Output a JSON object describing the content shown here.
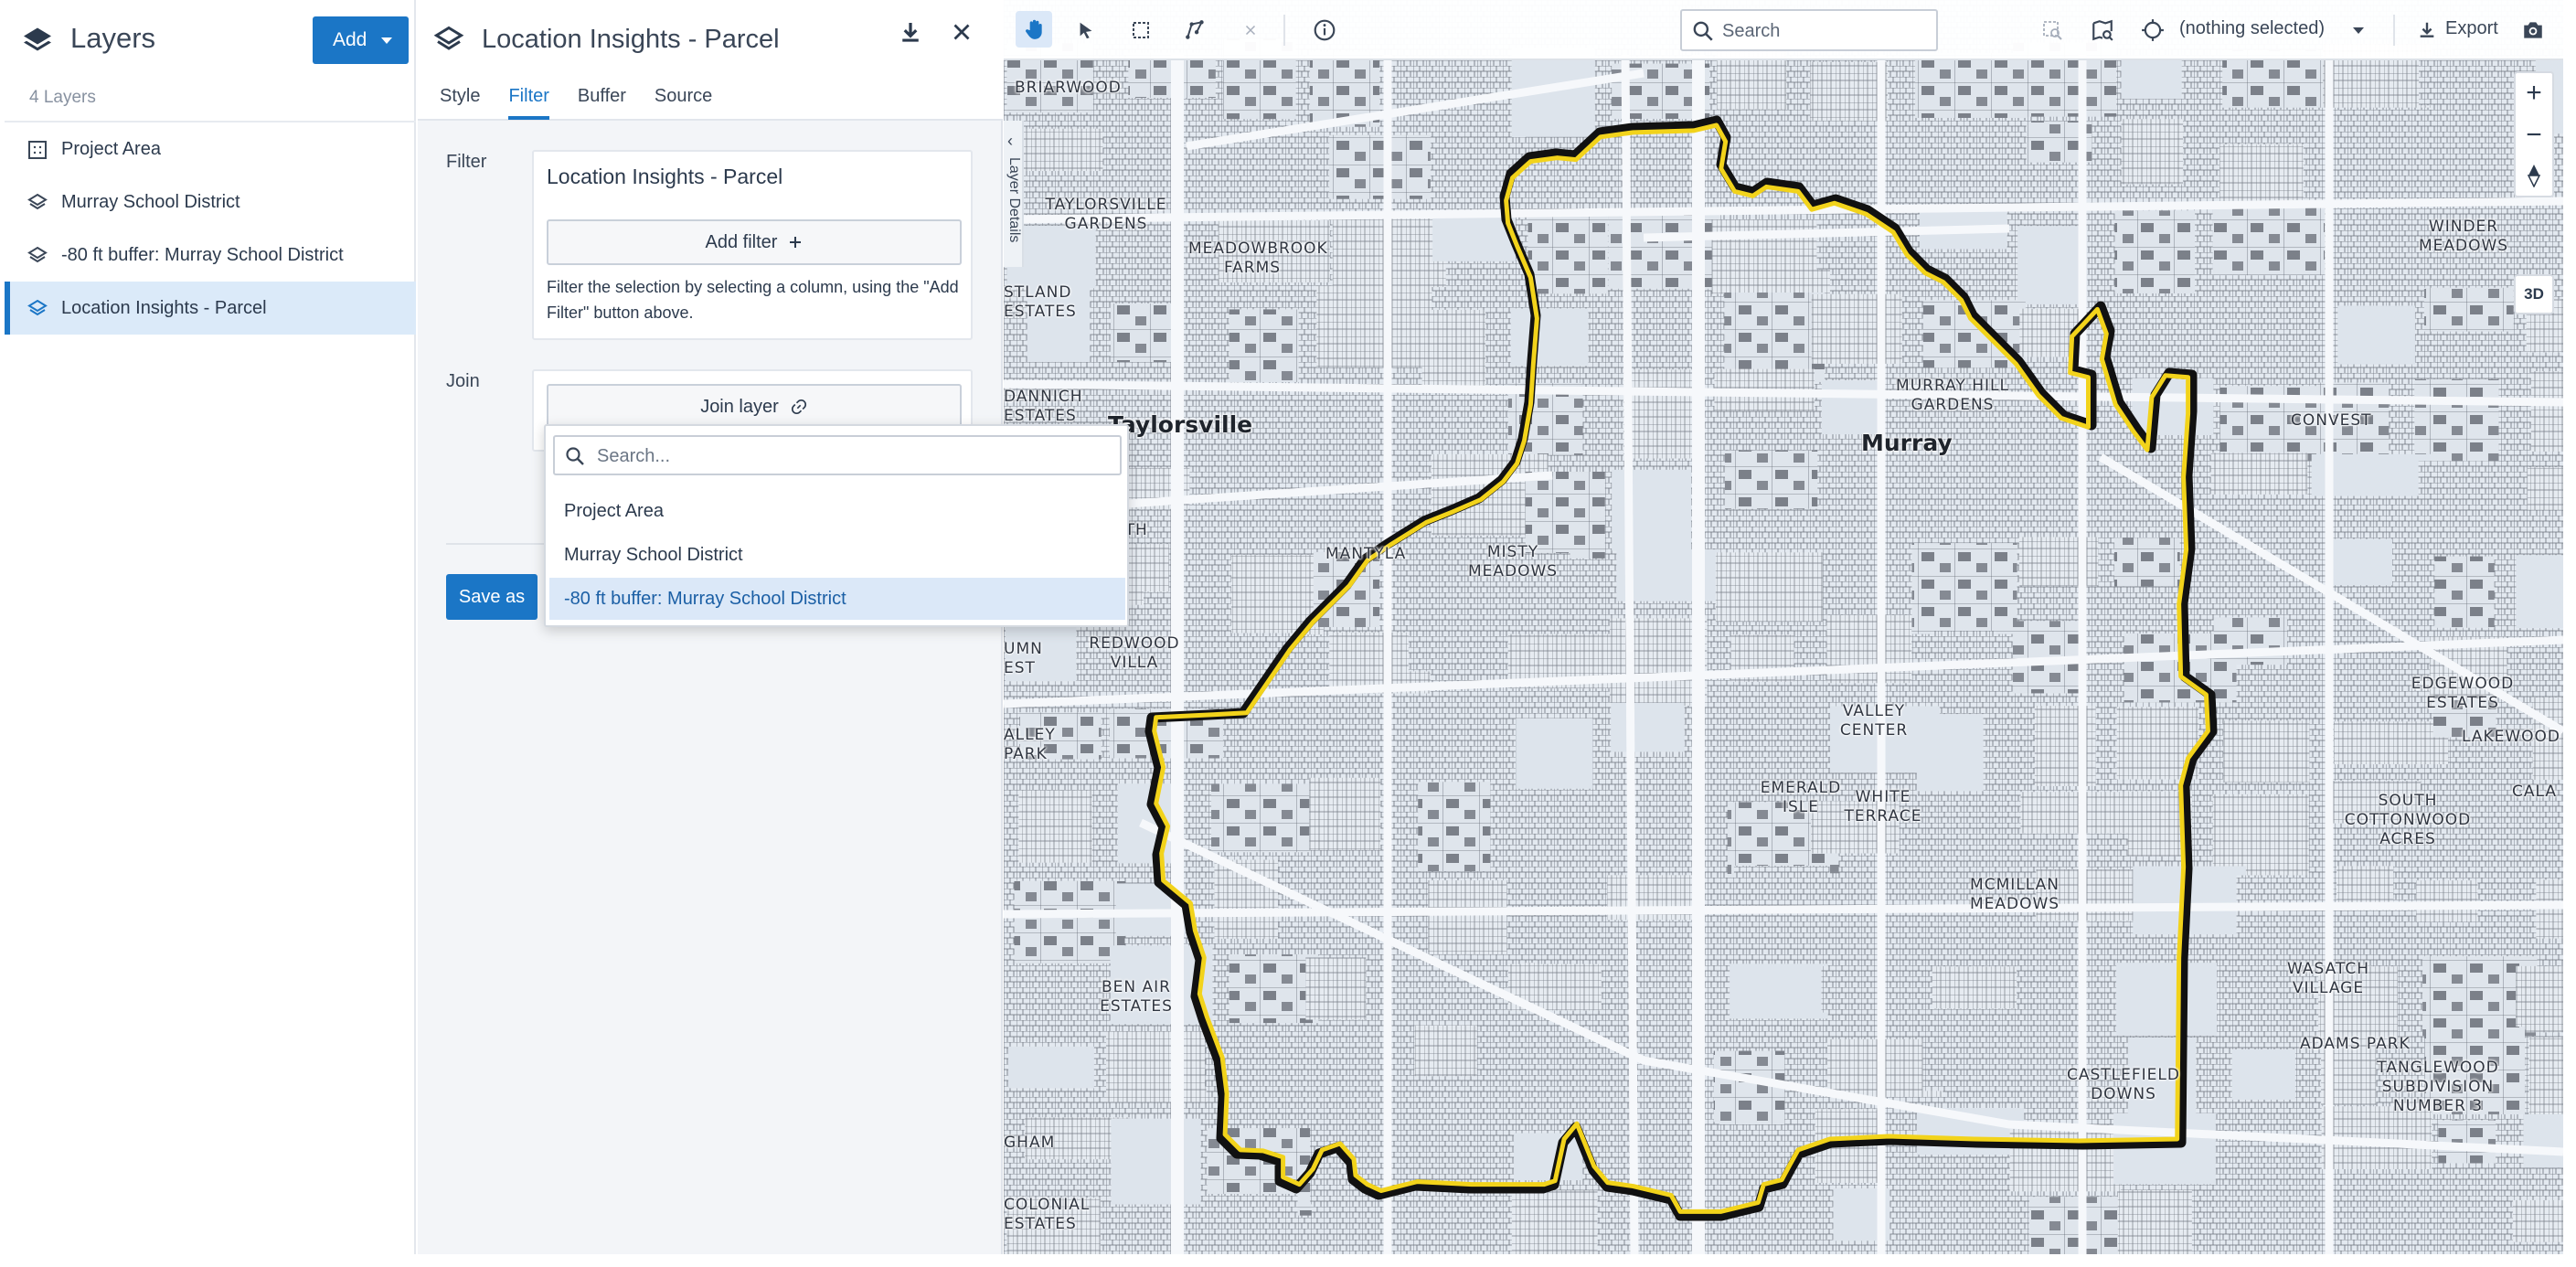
{
  "layers_panel": {
    "title": "Layers",
    "add_label": "Add",
    "count_label": "4 Layers",
    "items": [
      {
        "label": "Project Area",
        "icon": "grid-icon"
      },
      {
        "label": "Murray School District",
        "icon": "layers-icon"
      },
      {
        "label": "-80 ft buffer: Murray School District",
        "icon": "layers-icon"
      },
      {
        "label": "Location Insights - Parcel",
        "icon": "layers-icon",
        "selected": true
      }
    ]
  },
  "details": {
    "title": "Location Insights - Parcel",
    "tabs": [
      {
        "label": "Style",
        "active": false
      },
      {
        "label": "Filter",
        "active": true
      },
      {
        "label": "Buffer",
        "active": false
      },
      {
        "label": "Source",
        "active": false
      }
    ],
    "filter": {
      "label": "Filter",
      "card_title": "Location Insights - Parcel",
      "add_filter_label": "Add filter",
      "help_text": "Filter the selection by selecting a column, using the \"Add Filter\" button above."
    },
    "join": {
      "label": "Join",
      "join_button_label": "Join layer"
    },
    "save_as_label": "Save as"
  },
  "join_dropdown": {
    "search_placeholder": "Search...",
    "options": [
      {
        "label": "Project Area",
        "highlighted": false
      },
      {
        "label": "Murray School District",
        "highlighted": false
      },
      {
        "label": "-80 ft buffer: Murray School District",
        "highlighted": true
      }
    ]
  },
  "map": {
    "toolbar": {
      "search_placeholder": "Search",
      "selection_label": "(nothing selected)",
      "export_label": "Export"
    },
    "layer_details_tab": "Layer Details",
    "controls": {
      "zoom_in": "+",
      "zoom_out": "−",
      "three_d": "3D"
    },
    "places": [
      {
        "text": "BRIARWOOD"
      },
      {
        "text": "TAYLORSVILLE GARDENS"
      },
      {
        "text": "MEADOWBROOK FARMS"
      },
      {
        "text": "STLAND ESTATES"
      },
      {
        "text": "DANNICH ESTATES"
      },
      {
        "text": "Taylorsville"
      },
      {
        "text": "PLYMOUTH VIEW"
      },
      {
        "text": "MANTYLA"
      },
      {
        "text": "MISTY MEADOWS"
      },
      {
        "text": "REDWOOD VILLA"
      },
      {
        "text": "UMN EST"
      },
      {
        "text": "ALLEY PARK"
      },
      {
        "text": "BEN AIR ESTATES"
      },
      {
        "text": "GHAM"
      },
      {
        "text": "COLONIAL ESTATES"
      },
      {
        "text": "MURRAY HILL GARDENS"
      },
      {
        "text": "Murray"
      },
      {
        "text": "CONVEST"
      },
      {
        "text": "WINDER MEADOWS"
      },
      {
        "text": "VALLEY CENTER"
      },
      {
        "text": "EMERALD ISLE"
      },
      {
        "text": "WHITE TERRACE"
      },
      {
        "text": "MCMILLAN MEADOWS"
      },
      {
        "text": "EDGEWOOD ESTATES"
      },
      {
        "text": "LAKEWOOD"
      },
      {
        "text": "SOUTH COTTONWOOD ACRES"
      },
      {
        "text": "CALA"
      },
      {
        "text": "WASATCH VILLAGE"
      },
      {
        "text": "ADAMS PARK"
      },
      {
        "text": "CASTLEFIELD DOWNS"
      },
      {
        "text": "TANGLEWOOD SUBDIVISION NUMBER 3"
      }
    ]
  },
  "colors": {
    "accent": "#1b76c6",
    "selected_bg": "#dbeaf9",
    "boundary_yellow": "#f2d31b",
    "boundary_black": "#111111"
  }
}
